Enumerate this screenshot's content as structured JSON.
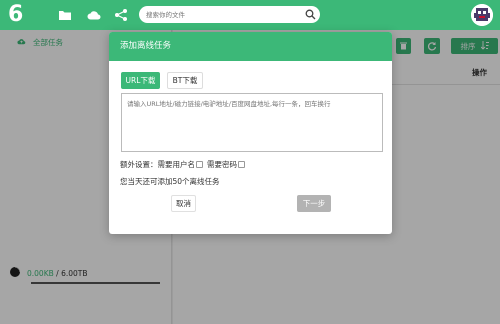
{
  "topbar": {
    "logo_text": "6",
    "icons": [
      "folder-icon",
      "cloud-icon",
      "share-icon"
    ],
    "search_placeholder": "搜索你的文件",
    "accent": "#3cb878"
  },
  "sidebar": {
    "item_label": "全部任务",
    "storage_used": "0.00KB",
    "storage_sep": "/",
    "storage_total": "6.00TB"
  },
  "main": {
    "sort_label": "排序",
    "column_operation": "操作"
  },
  "modal": {
    "title": "添加离线任务",
    "tab_url": "URL下载",
    "tab_bt": "BT下载",
    "url_placeholder": "请输入URL地址/磁力链接/电驴地址/百度网盘地址,每行一条，回车换行",
    "extra_label": "额外设置：",
    "need_username": "需要用户名",
    "need_password": "需要密码",
    "quota_text": "您当天还可添加50个离线任务",
    "cancel_label": "取消",
    "next_label": "下一步"
  }
}
